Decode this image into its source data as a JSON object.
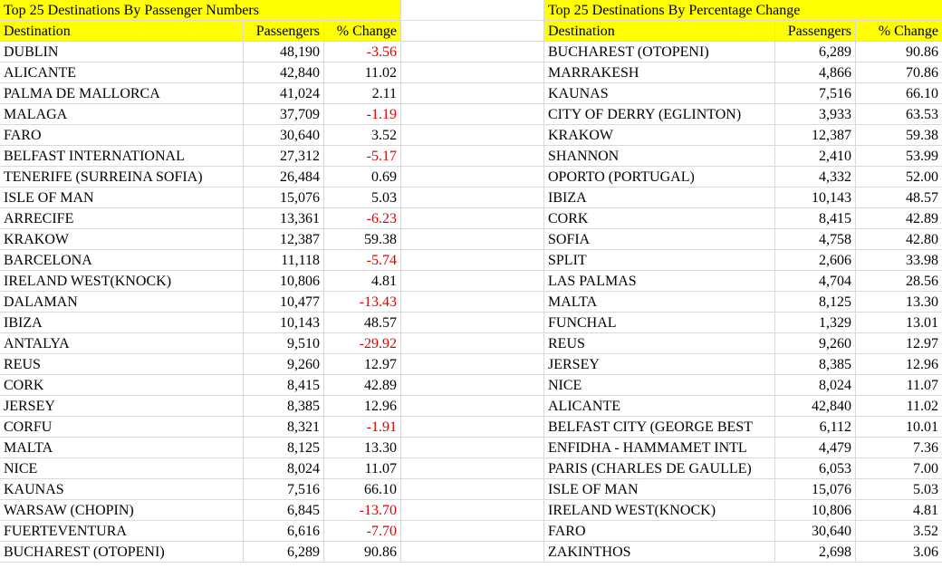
{
  "left_table": {
    "title": "Top 25 Destinations By Passenger Numbers",
    "headers": {
      "destination": "Destination",
      "passengers": "Passengers",
      "change": "% Change"
    },
    "rows": [
      {
        "destination": "DUBLIN",
        "passengers": "48,190",
        "change": "-3.56"
      },
      {
        "destination": "ALICANTE",
        "passengers": "42,840",
        "change": "11.02"
      },
      {
        "destination": "PALMA DE MALLORCA",
        "passengers": "41,024",
        "change": "2.11"
      },
      {
        "destination": "MALAGA",
        "passengers": "37,709",
        "change": "-1.19"
      },
      {
        "destination": "FARO",
        "passengers": "30,640",
        "change": "3.52"
      },
      {
        "destination": "BELFAST INTERNATIONAL",
        "passengers": "27,312",
        "change": "-5.17"
      },
      {
        "destination": "TENERIFE (SURREINA SOFIA)",
        "passengers": "26,484",
        "change": "0.69"
      },
      {
        "destination": "ISLE OF MAN",
        "passengers": "15,076",
        "change": "5.03"
      },
      {
        "destination": "ARRECIFE",
        "passengers": "13,361",
        "change": "-6.23"
      },
      {
        "destination": "KRAKOW",
        "passengers": "12,387",
        "change": "59.38"
      },
      {
        "destination": "BARCELONA",
        "passengers": "11,118",
        "change": "-5.74"
      },
      {
        "destination": "IRELAND WEST(KNOCK)",
        "passengers": "10,806",
        "change": "4.81"
      },
      {
        "destination": "DALAMAN",
        "passengers": "10,477",
        "change": "-13.43"
      },
      {
        "destination": "IBIZA",
        "passengers": "10,143",
        "change": "48.57"
      },
      {
        "destination": "ANTALYA",
        "passengers": "9,510",
        "change": "-29.92"
      },
      {
        "destination": "REUS",
        "passengers": "9,260",
        "change": "12.97"
      },
      {
        "destination": "CORK",
        "passengers": "8,415",
        "change": "42.89"
      },
      {
        "destination": "JERSEY",
        "passengers": "8,385",
        "change": "12.96"
      },
      {
        "destination": "CORFU",
        "passengers": "8,321",
        "change": "-1.91"
      },
      {
        "destination": "MALTA",
        "passengers": "8,125",
        "change": "13.30"
      },
      {
        "destination": "NICE",
        "passengers": "8,024",
        "change": "11.07"
      },
      {
        "destination": "KAUNAS",
        "passengers": "7,516",
        "change": "66.10"
      },
      {
        "destination": "WARSAW (CHOPIN)",
        "passengers": "6,845",
        "change": "-13.70"
      },
      {
        "destination": "FUERTEVENTURA",
        "passengers": "6,616",
        "change": "-7.70"
      },
      {
        "destination": "BUCHAREST (OTOPENI)",
        "passengers": "6,289",
        "change": "90.86"
      }
    ]
  },
  "right_table": {
    "title": "Top 25 Destinations By Percentage Change",
    "headers": {
      "destination": "Destination",
      "passengers": "Passengers",
      "change": "% Change"
    },
    "rows": [
      {
        "destination": "BUCHAREST (OTOPENI)",
        "passengers": "6,289",
        "change": "90.86"
      },
      {
        "destination": "MARRAKESH",
        "passengers": "4,866",
        "change": "70.86"
      },
      {
        "destination": "KAUNAS",
        "passengers": "7,516",
        "change": "66.10"
      },
      {
        "destination": "CITY OF DERRY (EGLINTON)",
        "passengers": "3,933",
        "change": "63.53"
      },
      {
        "destination": "KRAKOW",
        "passengers": "12,387",
        "change": "59.38"
      },
      {
        "destination": "SHANNON",
        "passengers": "2,410",
        "change": "53.99"
      },
      {
        "destination": "OPORTO (PORTUGAL)",
        "passengers": "4,332",
        "change": "52.00"
      },
      {
        "destination": "IBIZA",
        "passengers": "10,143",
        "change": "48.57"
      },
      {
        "destination": "CORK",
        "passengers": "8,415",
        "change": "42.89"
      },
      {
        "destination": "SOFIA",
        "passengers": "4,758",
        "change": "42.80"
      },
      {
        "destination": "SPLIT",
        "passengers": "2,606",
        "change": "33.98"
      },
      {
        "destination": "LAS PALMAS",
        "passengers": "4,704",
        "change": "28.56"
      },
      {
        "destination": "MALTA",
        "passengers": "8,125",
        "change": "13.30"
      },
      {
        "destination": "FUNCHAL",
        "passengers": "1,329",
        "change": "13.01"
      },
      {
        "destination": "REUS",
        "passengers": "9,260",
        "change": "12.97"
      },
      {
        "destination": "JERSEY",
        "passengers": "8,385",
        "change": "12.96"
      },
      {
        "destination": "NICE",
        "passengers": "8,024",
        "change": "11.07"
      },
      {
        "destination": "ALICANTE",
        "passengers": "42,840",
        "change": "11.02"
      },
      {
        "destination": "BELFAST CITY (GEORGE BEST",
        "passengers": "6,112",
        "change": "10.01"
      },
      {
        "destination": "ENFIDHA - HAMMAMET INTL",
        "passengers": "4,479",
        "change": "7.36"
      },
      {
        "destination": "PARIS (CHARLES DE GAULLE)",
        "passengers": "6,053",
        "change": "7.00"
      },
      {
        "destination": "ISLE OF MAN",
        "passengers": "15,076",
        "change": "5.03"
      },
      {
        "destination": "IRELAND WEST(KNOCK)",
        "passengers": "10,806",
        "change": "4.81"
      },
      {
        "destination": "FARO",
        "passengers": "30,640",
        "change": "3.52"
      },
      {
        "destination": "ZAKINTHOS",
        "passengers": "2,698",
        "change": "3.06"
      }
    ]
  },
  "colors": {
    "header_fill": "#ffff00",
    "negative": "#e00000",
    "grid": "#d9d9d9"
  }
}
